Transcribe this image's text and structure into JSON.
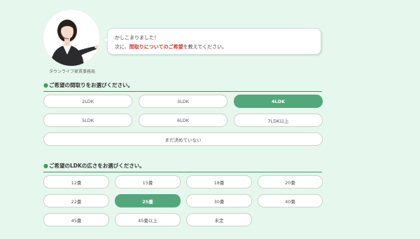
{
  "agent": {
    "caption": "タウンライフ家賃事務局"
  },
  "message": {
    "line1": "かしこまりました！",
    "line2_prefix": "次に、",
    "line2_emphasis": "間取りについてのご希望",
    "line2_suffix": "を教えてください。"
  },
  "layout_section": {
    "pin_icon": "📍",
    "title": "ご希望の間取りをお選びください。",
    "options": [
      "2LDK",
      "3LDK",
      "4LDK",
      "5LDK",
      "6LDK",
      "7LDK以上",
      "まだ決めていない"
    ],
    "selected": "4LDK"
  },
  "size_section": {
    "pin_icon": "📍",
    "title": "ご希望のLDKの広さをお選びください。",
    "options": [
      "12畳",
      "15畳",
      "18畳",
      "20畳",
      "22畳",
      "25畳",
      "30畳",
      "40畳",
      "45畳",
      "45畳以上",
      "未定"
    ],
    "selected": "25畳"
  },
  "colors": {
    "accent": "#52a87b",
    "background": "#e6f7ed",
    "emphasis": "#d0342c"
  }
}
